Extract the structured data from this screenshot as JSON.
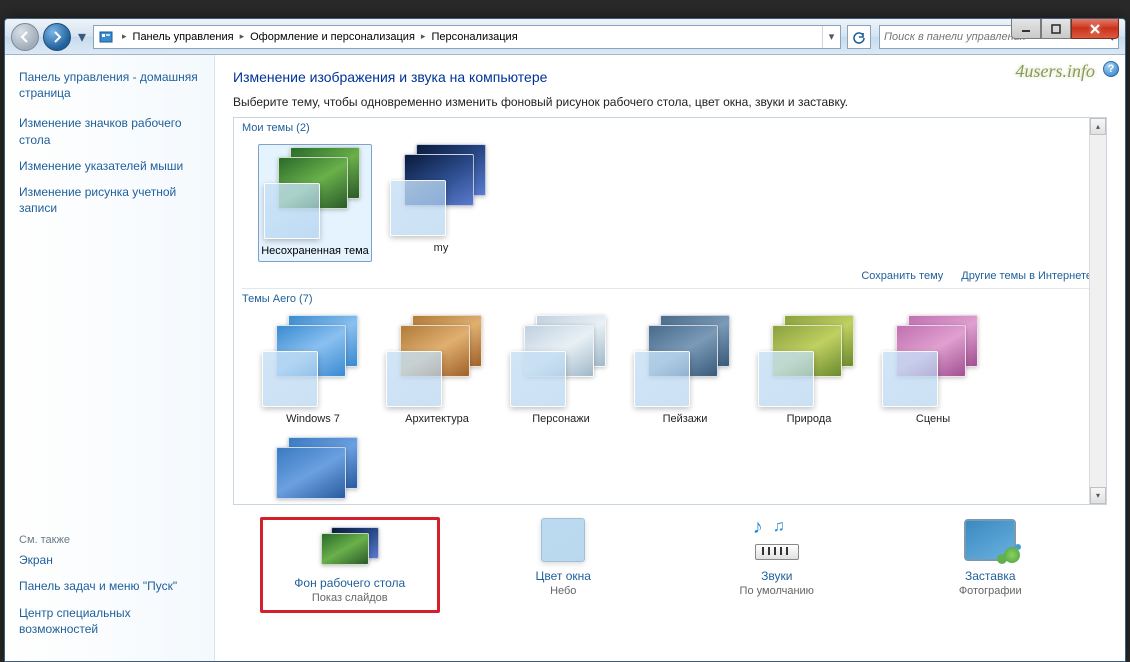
{
  "breadcrumb": {
    "seg1": "Панель управления",
    "seg2": "Оформление и персонализация",
    "seg3": "Персонализация"
  },
  "search": {
    "placeholder": "Поиск в панели управления"
  },
  "sidebar": {
    "home": "Панель управления - домашняя страница",
    "links": [
      "Изменение значков рабочего стола",
      "Изменение указателей мыши",
      "Изменение рисунка учетной записи"
    ],
    "see_also_label": "См. также",
    "see_also": [
      "Экран",
      "Панель задач и меню \"Пуск\"",
      "Центр специальных возможностей"
    ]
  },
  "main": {
    "title": "Изменение изображения и звука на компьютере",
    "desc": "Выберите тему, чтобы одновременно изменить фоновый рисунок рабочего стола, цвет окна, звуки и заставку.",
    "watermark": "4users.info"
  },
  "groups": {
    "my_themes": {
      "label": "Мои темы (2)",
      "items": [
        "Несохраненная тема",
        "my"
      ]
    },
    "my_actions": {
      "save": "Сохранить тему",
      "more": "Другие темы в Интернете"
    },
    "aero": {
      "label": "Темы Aero (7)",
      "items": [
        "Windows 7",
        "Архитектура",
        "Персонажи",
        "Пейзажи",
        "Природа",
        "Сцены"
      ]
    }
  },
  "options": {
    "desktop": {
      "title": "Фон рабочего стола",
      "sub": "Показ слайдов"
    },
    "color": {
      "title": "Цвет окна",
      "sub": "Небо"
    },
    "sounds": {
      "title": "Звуки",
      "sub": "По умолчанию"
    },
    "saver": {
      "title": "Заставка",
      "sub": "Фотографии"
    }
  }
}
